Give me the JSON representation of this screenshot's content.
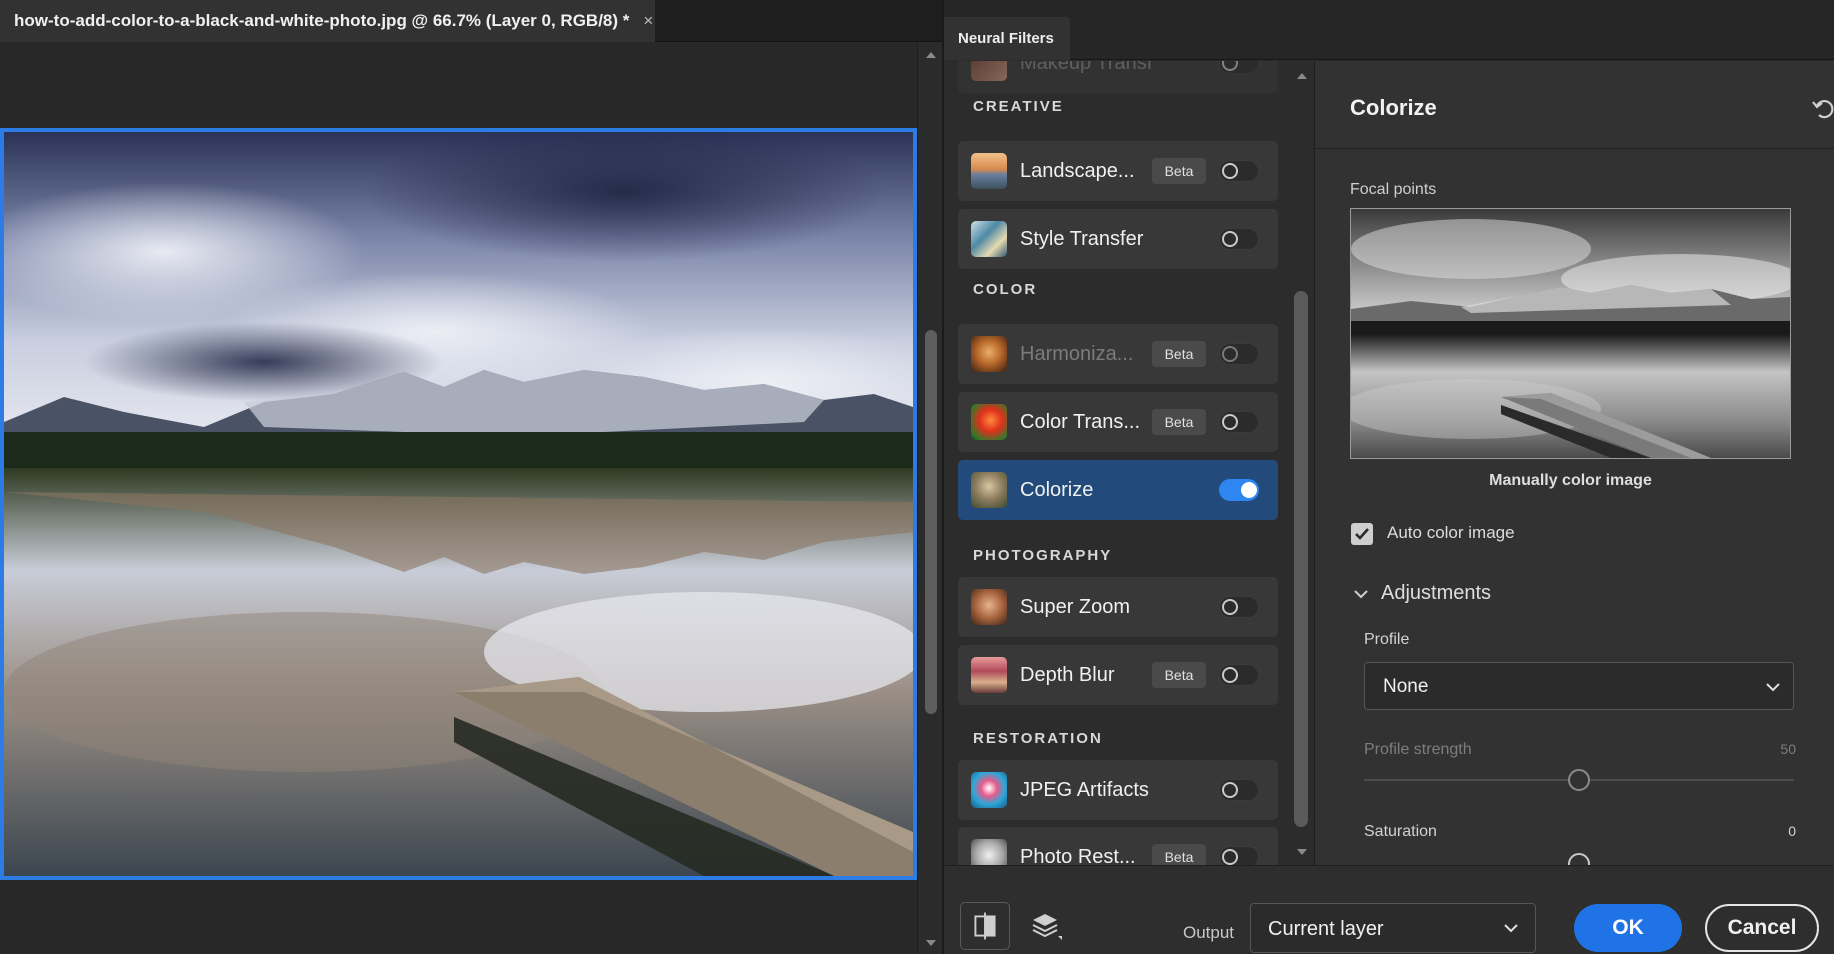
{
  "document": {
    "tab_title": "how-to-add-color-to-a-black-and-white-photo.jpg @ 66.7% (Layer 0, RGB/8) *",
    "close_glyph": "×"
  },
  "panel": {
    "tab_title": "Neural Filters"
  },
  "filters": {
    "partial_item": {
      "label": "Makeup Transfer"
    },
    "categories": [
      {
        "title": "CREATIVE",
        "items": [
          {
            "label": "Landscape...",
            "beta": "Beta",
            "enabled": false
          },
          {
            "label": "Style Transfer",
            "enabled": false
          }
        ]
      },
      {
        "title": "COLOR",
        "items": [
          {
            "label": "Harmoniza...",
            "beta": "Beta",
            "enabled": false,
            "dimmed": true
          },
          {
            "label": "Color Trans...",
            "beta": "Beta",
            "enabled": false
          },
          {
            "label": "Colorize",
            "enabled": true,
            "selected": true
          }
        ]
      },
      {
        "title": "PHOTOGRAPHY",
        "items": [
          {
            "label": "Super Zoom",
            "enabled": false
          },
          {
            "label": "Depth Blur",
            "beta": "Beta",
            "enabled": false
          }
        ]
      },
      {
        "title": "RESTORATION",
        "items": [
          {
            "label": "JPEG Artifacts Re...",
            "enabled": false
          },
          {
            "label": "Photo Rest...",
            "beta": "Beta",
            "enabled": false
          }
        ]
      }
    ]
  },
  "settings": {
    "title": "Colorize",
    "focal_points_label": "Focal points",
    "manual_color_label": "Manually color image",
    "auto_color": {
      "label": "Auto color image",
      "checked": true
    },
    "adjustments": {
      "label": "Adjustments",
      "expanded": true,
      "profile_label": "Profile",
      "profile_value": "None",
      "profile_strength": {
        "label": "Profile strength",
        "value": "50",
        "disabled": true
      },
      "saturation": {
        "label": "Saturation",
        "value": "0"
      }
    }
  },
  "bottom_bar": {
    "output_label": "Output",
    "output_value": "Current layer",
    "ok_label": "OK",
    "cancel_label": "Cancel"
  },
  "colors": {
    "accent": "#1f73e6",
    "selected_item": "#224a7b",
    "canvas_border": "#2d7be5"
  }
}
